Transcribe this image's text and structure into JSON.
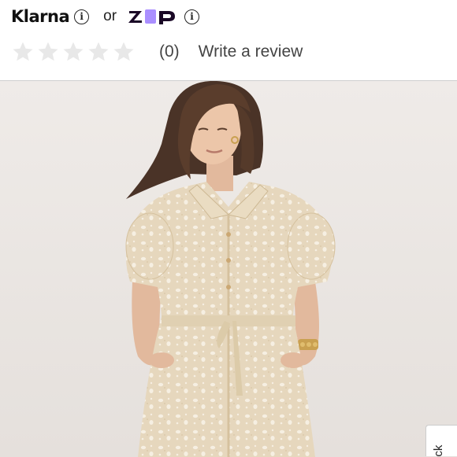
{
  "payment": {
    "klarna_label": "Klarna",
    "or_label": "or",
    "zip_label": "zip",
    "info_glyph": "i",
    "zip_color": "#aa8fff"
  },
  "reviews": {
    "stars_total": 5,
    "rating": 0,
    "count_label": "(0)",
    "write_review_label": "Write a review"
  },
  "product_image": {
    "icon": "product-photo-dress-model",
    "background_color": "#ebe7e4",
    "dress_color": "#e6d7bd"
  },
  "feedback_tab": {
    "label": "ack"
  }
}
